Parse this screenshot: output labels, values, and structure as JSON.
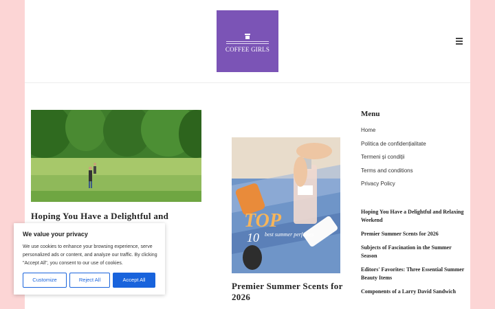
{
  "site": {
    "logo_text": "COFFEE GIRLS",
    "brand_color": "#7b54b6",
    "background_color": "#fcd5d5"
  },
  "header": {
    "menu_icon": "hamburger-menu-icon"
  },
  "posts": [
    {
      "title": "Hoping You Have a Delightful and",
      "image": "meadow-walk-photo"
    },
    {
      "title": "Premier Summer Scents for 2026",
      "image": "summer-perfumes-photo",
      "overlay_big": "TOP",
      "overlay_num": "10",
      "overlay_sub": "best summer perfumes"
    }
  ],
  "sidebar": {
    "menu_heading": "Menu",
    "menu_items": [
      "Home",
      "Politica de confidențialitate",
      "Termeni și condiții",
      "Terms and conditions",
      "Privacy Policy"
    ],
    "recent_posts": [
      "Hoping You Have a Delightful and Relaxing Weekend",
      "Premier Summer Scents for 2026",
      "Subjects of Fascination in the Summer Season",
      "Editors' Favorites: Three Essential Summer Beauty Items",
      "Components of a Larry David Sandwich"
    ]
  },
  "cookie": {
    "title": "We value your privacy",
    "text": "We use cookies to enhance your browsing experience, serve personalized ads or content, and analyze our traffic. By clicking \"Accept All\", you consent to our use of cookies.",
    "customize_label": "Customize",
    "reject_label": "Reject All",
    "accept_label": "Accept All",
    "accent_color": "#1863dc"
  }
}
